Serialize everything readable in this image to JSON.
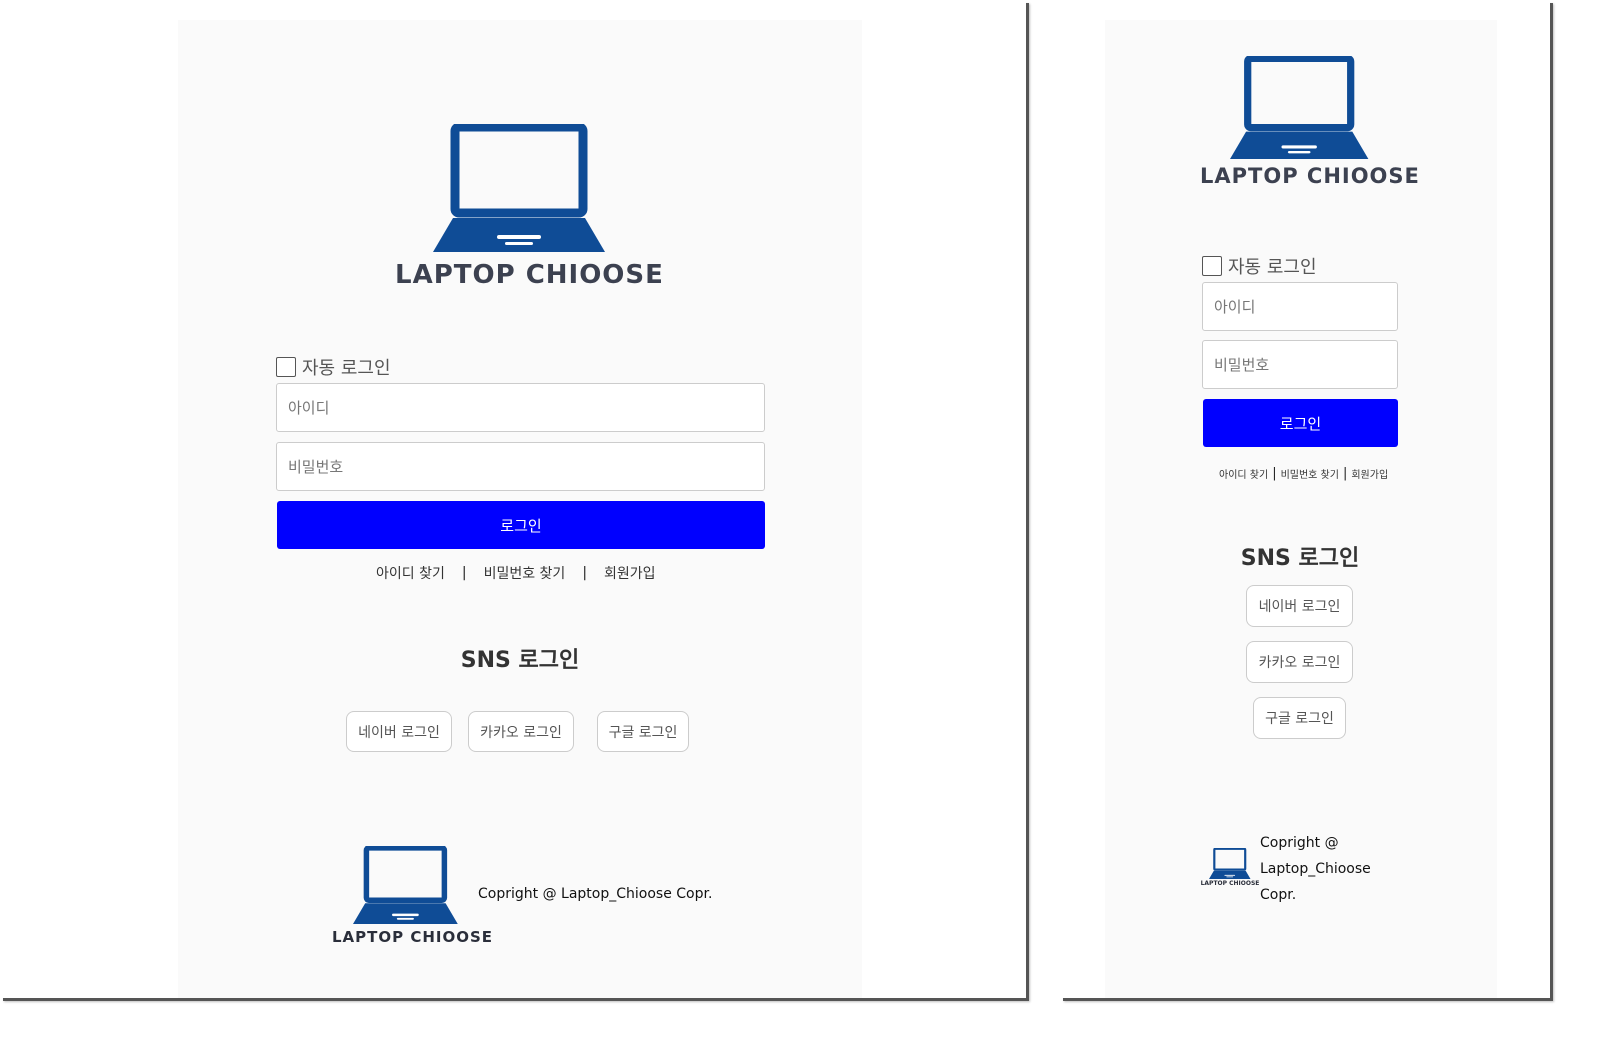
{
  "brand": {
    "name": "LAPTOP CHIOOSE",
    "logo_color": "#0f4c96"
  },
  "login": {
    "auto_login_label": "자동 로그인",
    "id_placeholder": "아이디",
    "password_placeholder": "비밀번호",
    "login_button": "로그인",
    "login_button_color": "#0000ff"
  },
  "links": {
    "find_id": "아이디 찾기",
    "find_password": "비밀번호 찾기",
    "signup": "회원가입",
    "separator": "|"
  },
  "sns": {
    "title": "SNS 로그인",
    "naver": "네이버 로그인",
    "kakao": "카카오 로그인",
    "google": "구글 로그인"
  },
  "footer": {
    "copyright": "Copright @ Laptop_Chioose Copr.",
    "copyright_line1": "Copright @",
    "copyright_line2": "Laptop_Chioose",
    "copyright_line3": "Copr."
  }
}
